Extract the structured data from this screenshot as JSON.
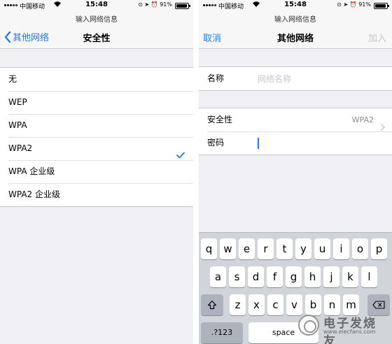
{
  "status_bar": {
    "carrier": "中国移动",
    "time": "15:48",
    "battery": "91%",
    "battery_level": 0.91
  },
  "left_screen": {
    "nav": {
      "prompt": "输入网络信息",
      "back_label": "其他网络",
      "title": "安全性"
    },
    "security_options": [
      {
        "label": "无"
      },
      {
        "label": "WEP"
      },
      {
        "label": "WPA"
      },
      {
        "label": "WPA2",
        "selected": true
      },
      {
        "label": "WPA 企业级"
      },
      {
        "label": "WPA2 企业级"
      }
    ]
  },
  "right_screen": {
    "nav": {
      "prompt": "输入网络信息",
      "cancel_label": "取消",
      "title": "其他网络",
      "join_label": "加入"
    },
    "name_field": {
      "label": "名称",
      "placeholder": "网络名称",
      "value": ""
    },
    "security_row": {
      "label": "安全性",
      "value": "WPA2"
    },
    "password_field": {
      "label": "密码",
      "value": ""
    },
    "keyboard": {
      "row1": [
        "q",
        "w",
        "e",
        "r",
        "t",
        "y",
        "u",
        "i",
        "o",
        "p"
      ],
      "row2": [
        "a",
        "s",
        "d",
        "f",
        "g",
        "h",
        "j",
        "k",
        "l"
      ],
      "row3": [
        "z",
        "x",
        "c",
        "v",
        "b",
        "n",
        "m"
      ],
      "numbers_label": ".?123",
      "space_label": "space"
    }
  },
  "watermark": {
    "text": "电子发烧友",
    "url": "www.elecfans.com"
  },
  "colors": {
    "accent": "#1a7cf0",
    "disabled": "#c7c7cc",
    "background": "#efeff4",
    "keyboard": "#d1d4d9"
  }
}
